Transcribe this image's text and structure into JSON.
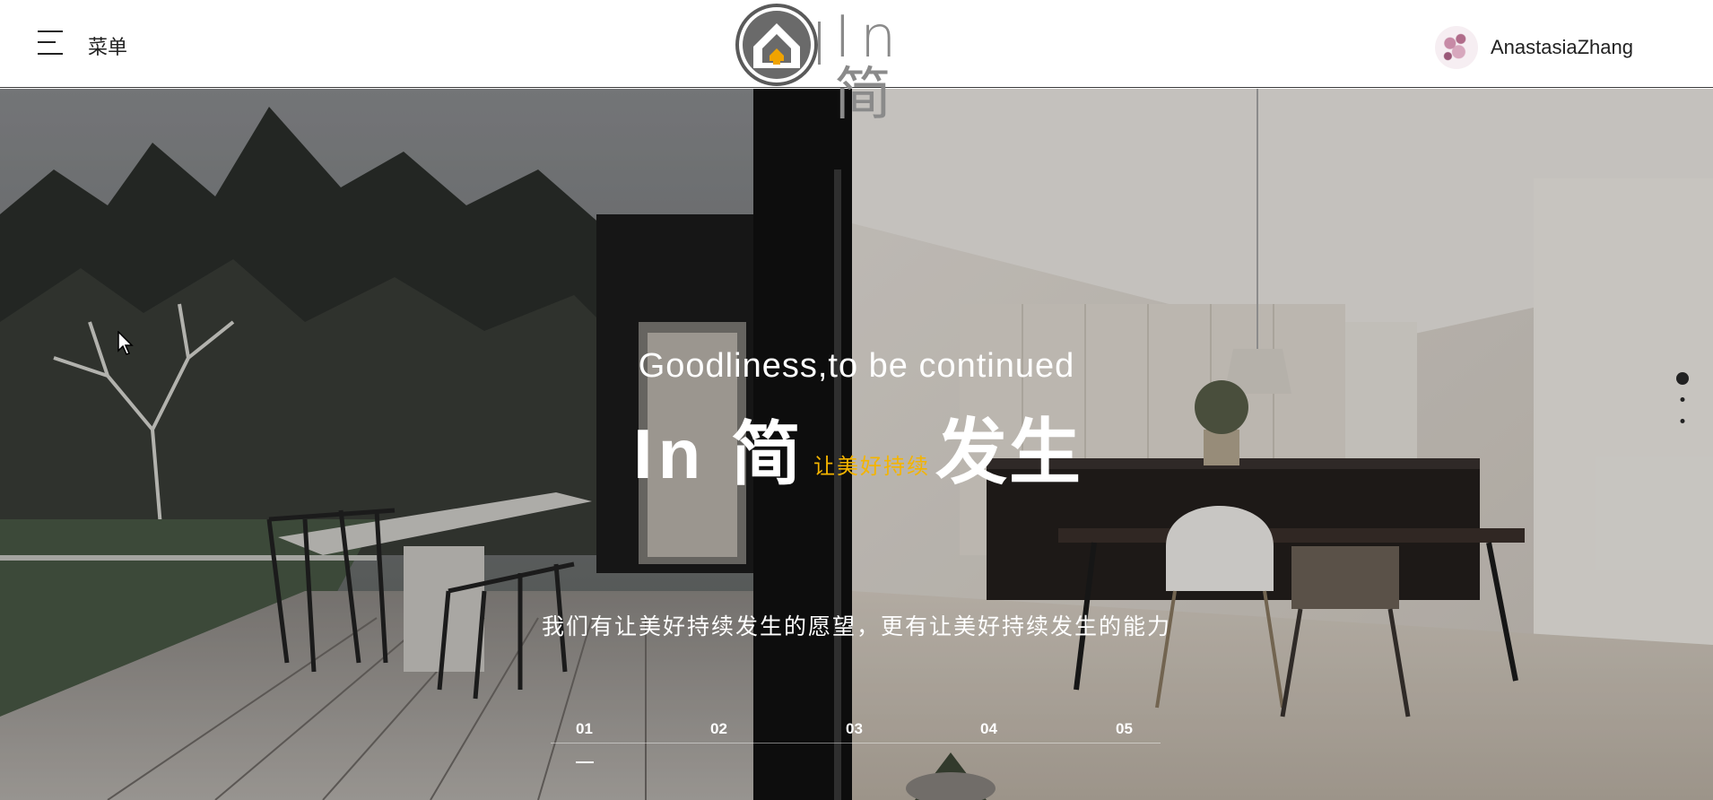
{
  "header": {
    "menu_label": "菜单",
    "logo_text": "In 简",
    "user_name": "AnastasiaZhang"
  },
  "hero": {
    "tagline": "Goodliness,to be continued",
    "title_in": "In 简",
    "title_slogan": "让美好持续",
    "title_happen": "发生",
    "subtitle": "我们有让美好持续发生的愿望，更有让美好持续发生的能力",
    "accent_color": "#f4b400"
  },
  "slider": {
    "items": [
      "01",
      "02",
      "03",
      "04",
      "05"
    ],
    "active_index": 0
  },
  "side_dots": {
    "count": 3,
    "active_index": 0
  }
}
